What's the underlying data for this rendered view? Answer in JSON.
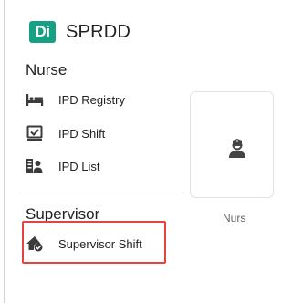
{
  "header": {
    "logo_text": "Di",
    "app_title": "SPRDD",
    "accent": "#18a085"
  },
  "sidebar": {
    "sections": [
      {
        "title": "Nurse",
        "items": [
          {
            "label": "IPD Registry",
            "icon": "bed-icon"
          },
          {
            "label": "IPD Shift",
            "icon": "check-box-icon"
          },
          {
            "label": "IPD List",
            "icon": "patient-list-icon"
          }
        ]
      },
      {
        "title": "Supervisor",
        "items": [
          {
            "label": "Supervisor Shift",
            "icon": "home-check-icon",
            "highlighted": true,
            "highlight_color": "#e4443f"
          }
        ]
      }
    ]
  },
  "main": {
    "card": {
      "icon": "nurse-icon",
      "label": "Nurs"
    }
  }
}
